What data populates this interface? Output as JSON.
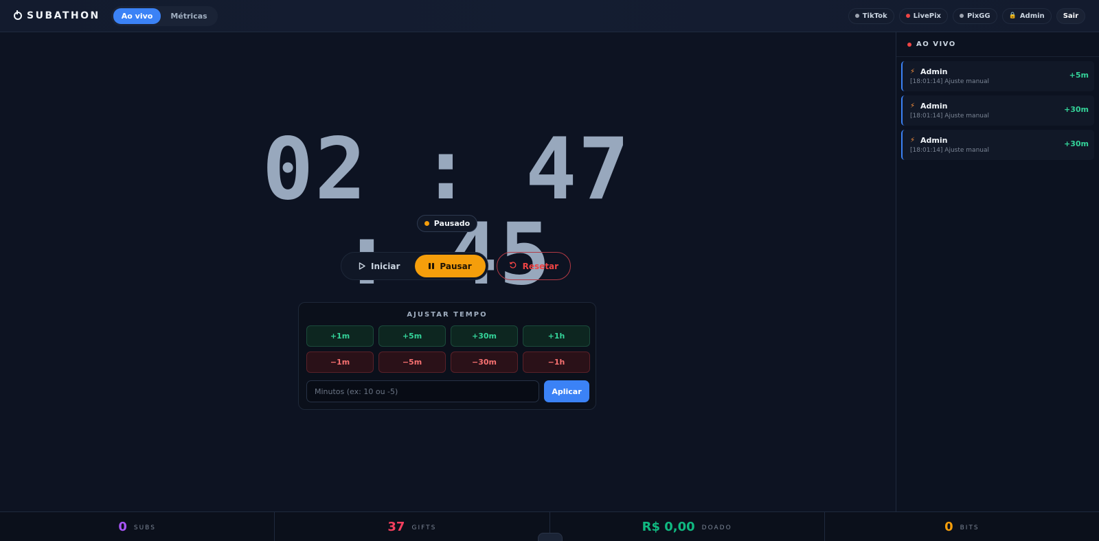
{
  "header": {
    "brand": "SUBATHON",
    "tabs": [
      {
        "label": "Ao vivo",
        "active": true
      },
      {
        "label": "Métricas",
        "active": false
      }
    ],
    "sources": [
      {
        "label": "TikTok",
        "dot_color": "#9ca3af"
      },
      {
        "label": "LivePix",
        "dot_color": "#ef4444"
      },
      {
        "label": "PixGG",
        "dot_color": "#9ca3af"
      }
    ],
    "admin_label": "Admin",
    "logout_label": "Sair"
  },
  "timer": {
    "display": "02:47:45",
    "status": "Pausado",
    "status_color": "#f59e0b"
  },
  "controls": {
    "start_label": "Iniciar",
    "pause_label": "Pausar",
    "reset_label": "Resetar"
  },
  "adjust": {
    "title": "AJUSTAR TEMPO",
    "plus": [
      "+1m",
      "+5m",
      "+30m",
      "+1h"
    ],
    "minus": [
      "−1m",
      "−5m",
      "−30m",
      "−1h"
    ],
    "input_placeholder": "Minutos (ex: 10 ou -5)",
    "apply_label": "Aplicar"
  },
  "sidebar": {
    "title": "AO VIVO",
    "items": [
      {
        "name": "Admin",
        "detail": "[18:01:14] Ajuste manual",
        "amount": "+5m"
      },
      {
        "name": "Admin",
        "detail": "[18:01:14] Ajuste manual",
        "amount": "+30m"
      },
      {
        "name": "Admin",
        "detail": "[18:01:14] Ajuste manual",
        "amount": "+30m"
      }
    ]
  },
  "stats": [
    {
      "value": "0",
      "label": "SUBS",
      "color": "#a855f7"
    },
    {
      "value": "37",
      "label": "GIFTS",
      "color": "#f43f5e"
    },
    {
      "value": "R$ 0,00",
      "label": "DOADO",
      "color": "#10b981"
    },
    {
      "value": "0",
      "label": "BITS",
      "color": "#f59e0b"
    }
  ]
}
